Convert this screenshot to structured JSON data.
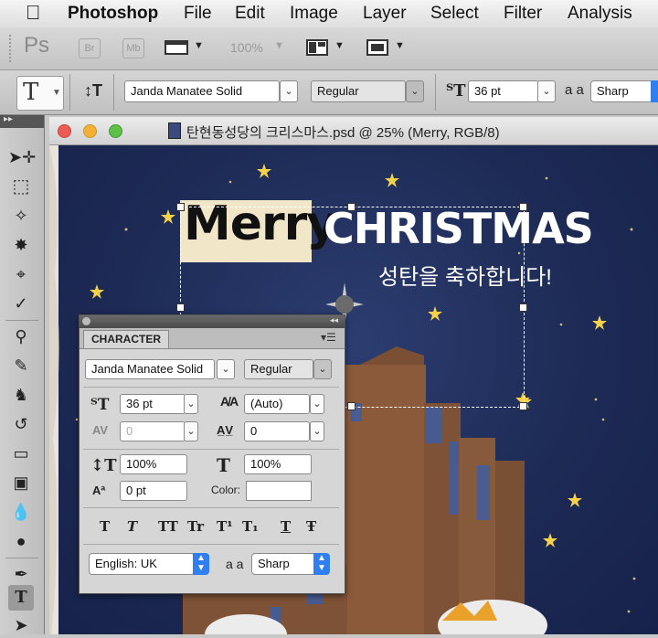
{
  "menubar": {
    "apple": "",
    "app_name": "Photoshop",
    "items": [
      "File",
      "Edit",
      "Image",
      "Layer",
      "Select",
      "Filter",
      "Analysis"
    ]
  },
  "appbar": {
    "ps_logo": "Ps",
    "br_label": "Br",
    "mb_label": "Mb",
    "zoom": "100%"
  },
  "options": {
    "font_family": "Janda Manatee Solid",
    "font_style": "Regular",
    "font_size": "36 pt",
    "aa_label": "a a",
    "antialias": "Sharp"
  },
  "document": {
    "title": "탄현동성당의 크리스마스.psd @ 25% (Merry, RGB/8)",
    "text_merry": "Merry",
    "text_christmas": "CHRISTMAS",
    "text_korean": "성탄을 축하합니다!"
  },
  "character_panel": {
    "tab": "CHARACTER",
    "font_family": "Janda Manatee Solid",
    "font_style": "Regular",
    "size": "36 pt",
    "leading": "(Auto)",
    "kerning": "0",
    "tracking": "0",
    "vscale": "100%",
    "hscale": "100%",
    "baseline": "0 pt",
    "color_label": "Color:",
    "style_buttons": [
      "T",
      "T",
      "TT",
      "Tr",
      "T¹",
      "T₁",
      "T",
      "Ŧ"
    ],
    "language": "English: UK",
    "aa_label": "a a",
    "antialias": "Sharp"
  },
  "colors": {
    "sky": "#1f2c58",
    "close": "#ec5b54",
    "minimize": "#f2b134",
    "zoom": "#5cc146",
    "star": "#f3d14a"
  }
}
